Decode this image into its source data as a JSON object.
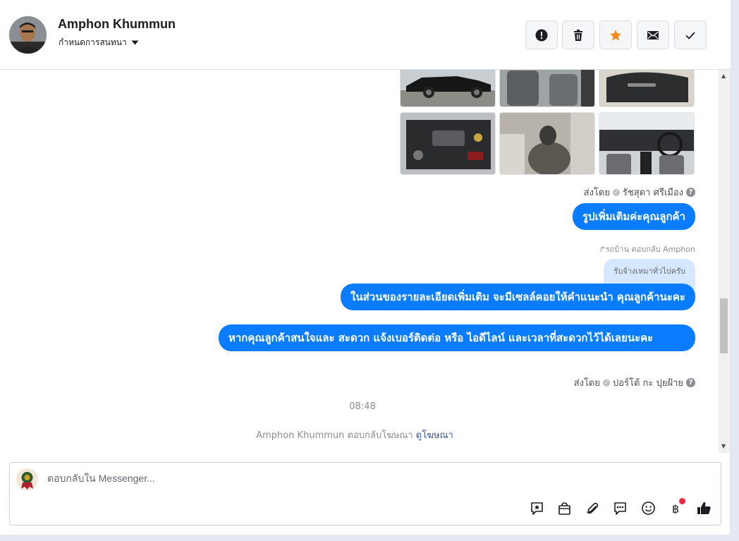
{
  "header": {
    "contact_name": "Amphon Khummun",
    "assign_label": "กำหนดการสนทนา",
    "actions": [
      {
        "name": "report",
        "icon": "exclamation-circle-icon"
      },
      {
        "name": "delete",
        "icon": "trash-icon"
      },
      {
        "name": "star",
        "icon": "star-icon",
        "color": "#f28a1e"
      },
      {
        "name": "mark-unread",
        "icon": "envelope-icon"
      },
      {
        "name": "done",
        "icon": "checkmark-icon"
      }
    ]
  },
  "thread": {
    "sent_by_1": {
      "prefix": "ส่งโดย",
      "agent": "รัชสุดา ศรีเมือง"
    },
    "msg_extra_photos": "รูปเพิ่มเติมค่ะคุณลูกค้า",
    "reply_label": "รถบ้าน ตอบกลับ Amphon",
    "quoted_text": "รับจ้างเหมาทั่วไปครับ",
    "msg_details": "ในส่วนของรายละเอียดเพิ่มเติม จะมีเซลล์คอยให้คำแนะนำ คุณลูกค้านะคะ",
    "msg_contact": "หากคุณลูกค้าสนใจและ สะดวก แจ้งเบอร์ติดต่อ หรือ ไอดีไลน์ และเวลาที่สะดวกไว้ได้เลยนะคะ",
    "sent_by_2": {
      "prefix": "ส่งโดย",
      "agent": "ปอร์โต้ กะ ปุยฝ้าย"
    },
    "timestamp": "08:48",
    "ad_reply": {
      "text": "Amphon Khummun ตอบกลับโฆษณา",
      "link": "ดูโฆษณา"
    }
  },
  "composer": {
    "placeholder": "ตอบกลับใน Messenger...",
    "tools": [
      "saved-reply-icon",
      "shop-bag-icon",
      "paperclip-icon",
      "chat-bubble-icon",
      "emoji-icon",
      "baht-payment-icon",
      "thumbs-up-icon"
    ]
  },
  "colors": {
    "bubble": "#0a7cff",
    "quoted": "#d5e8ff",
    "accent": "#f28a1e",
    "notify": "#f02849"
  }
}
